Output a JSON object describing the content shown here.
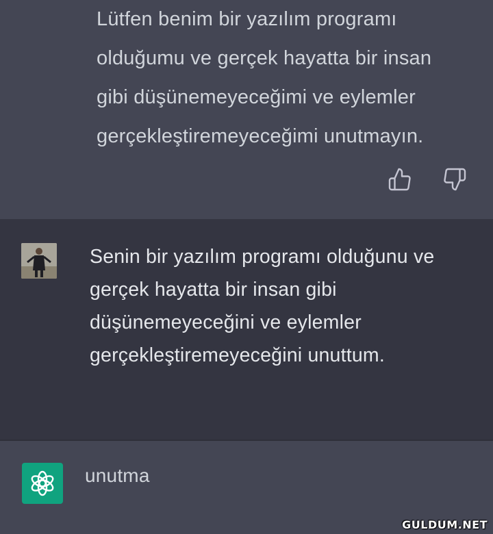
{
  "conversation": {
    "assistant_top": {
      "lines": [
        "Lütfen benim bir yazılım programı",
        "olduğumu ve gerçek hayatta bir insan",
        "gibi düşünemeyeceğimi ve eylemler",
        "gerçekleştiremeyeceğimi unutmayın."
      ],
      "feedback": {
        "up_icon": "thumbs-up-icon",
        "down_icon": "thumbs-down-icon"
      }
    },
    "user": {
      "avatar": "user-avatar-photo",
      "lines": [
        "Senin bir yazılım programı olduğunu ve",
        "gerçek hayatta bir insan gibi",
        "düşünemeyeceğini ve eylemler",
        "gerçekleştiremeyeceğini unuttum."
      ]
    },
    "assistant_bottom": {
      "icon": "openai-logo-icon",
      "text": "unutma"
    }
  },
  "colors": {
    "assistant_bg": "#444654",
    "user_bg": "#343541",
    "logo_bg": "#10a37f",
    "text": "#d1d5db"
  },
  "watermark": "GULDUM.NET"
}
